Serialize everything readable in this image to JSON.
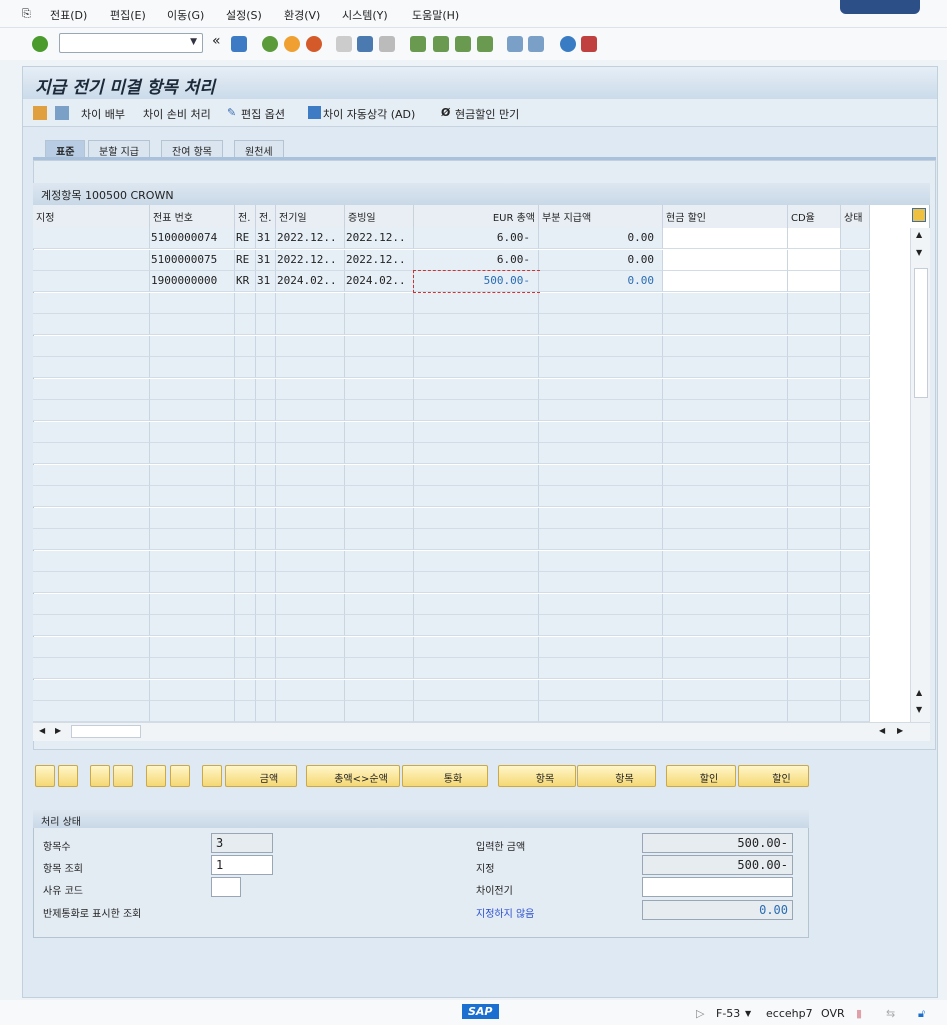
{
  "menu": [
    "전표(D)",
    "편집(E)",
    "이동(G)",
    "설정(S)",
    "환경(V)",
    "시스템(Y)",
    "도움말(H)"
  ],
  "command_field": "",
  "title": "지급 전기 미결 항목 처리",
  "app_toolbar": [
    "차이 배부",
    "차이 손비 처리",
    "편집 옵션",
    "차이 자동상각 (AD)",
    "현금할인 만기"
  ],
  "tabs": [
    "표준",
    "분할 지급",
    "잔여 항목",
    "원천세"
  ],
  "grid": {
    "title": "계정항목 100500 CROWN",
    "headers": [
      "지정",
      "전표 번호",
      "전.",
      "전.",
      "전기일",
      "증빙일",
      "EUR 총액",
      "부분 지급액",
      "현금 할인",
      "CD율",
      "상태"
    ],
    "rows": [
      [
        "",
        "5100000074",
        "RE",
        "31",
        "2022.12..",
        "2022.12..",
        "6.00-",
        "0.00",
        "",
        "",
        ""
      ],
      [
        "",
        "5100000075",
        "RE",
        "31",
        "2022.12..",
        "2022.12..",
        "6.00-",
        "0.00",
        "",
        "",
        ""
      ],
      [
        "",
        "1900000000",
        "KR",
        "31",
        "2024.02..",
        "2024.02..",
        "500.00-",
        "0.00",
        "",
        "",
        ""
      ]
    ]
  },
  "buttons": [
    "금액",
    "총액<>순액",
    "통화",
    "항목",
    "항목",
    "할인",
    "할인"
  ],
  "status": {
    "title": "처리 상태",
    "item_count_label": "항목수",
    "item_count": "3",
    "item_display_label": "항목 조회",
    "item_display": "1",
    "reason_code_label": "사유 코드",
    "reason_code": "",
    "clearing_currency_label": "반제통화로 표시한 조회",
    "entered_amount_label": "입력한 금액",
    "entered_amount": "500.00-",
    "assigned_label": "지정",
    "assigned": "500.00-",
    "difference_label": "차이전기",
    "difference": "",
    "not_assigned_label": "지정하지 않음",
    "not_assigned": "0.00"
  },
  "footer": {
    "tcode": "F-53",
    "system": "eccehp7",
    "mode": "OVR",
    "logo": "SAP"
  }
}
